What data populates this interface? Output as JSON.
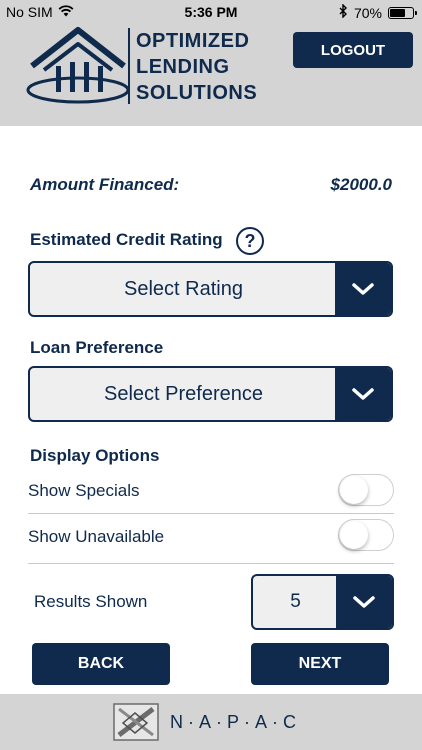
{
  "status": {
    "carrier": "No SIM",
    "time": "5:36 PM",
    "battery": "70%"
  },
  "header": {
    "brand_line1": "OPTIMIZED",
    "brand_line2": "LENDING",
    "brand_line3": "SOLUTIONS",
    "logout_label": "LOGOUT"
  },
  "amount": {
    "label": "Amount Financed:",
    "value": "$2000.0"
  },
  "credit": {
    "label": "Estimated Credit Rating",
    "help": "?",
    "value": "Select Rating"
  },
  "loan": {
    "label": "Loan Preference",
    "value": "Select Preference"
  },
  "display": {
    "label": "Display Options",
    "options": [
      {
        "label": "Show Specials",
        "on": false
      },
      {
        "label": "Show Unavailable",
        "on": false
      }
    ]
  },
  "results": {
    "label": "Results Shown",
    "value": "5"
  },
  "nav": {
    "back_label": "BACK",
    "next_label": "NEXT"
  },
  "footer": {
    "brand": "N·A·P·A·C"
  },
  "colors": {
    "navy": "#0f2a4c",
    "header_bg": "#d4d4d4",
    "select_bg": "#efefef"
  },
  "icons": [
    "wifi-icon",
    "bluetooth-icon",
    "battery-icon",
    "house-logo-icon",
    "help-icon",
    "chevron-down-icon",
    "napac-logo-icon"
  ]
}
